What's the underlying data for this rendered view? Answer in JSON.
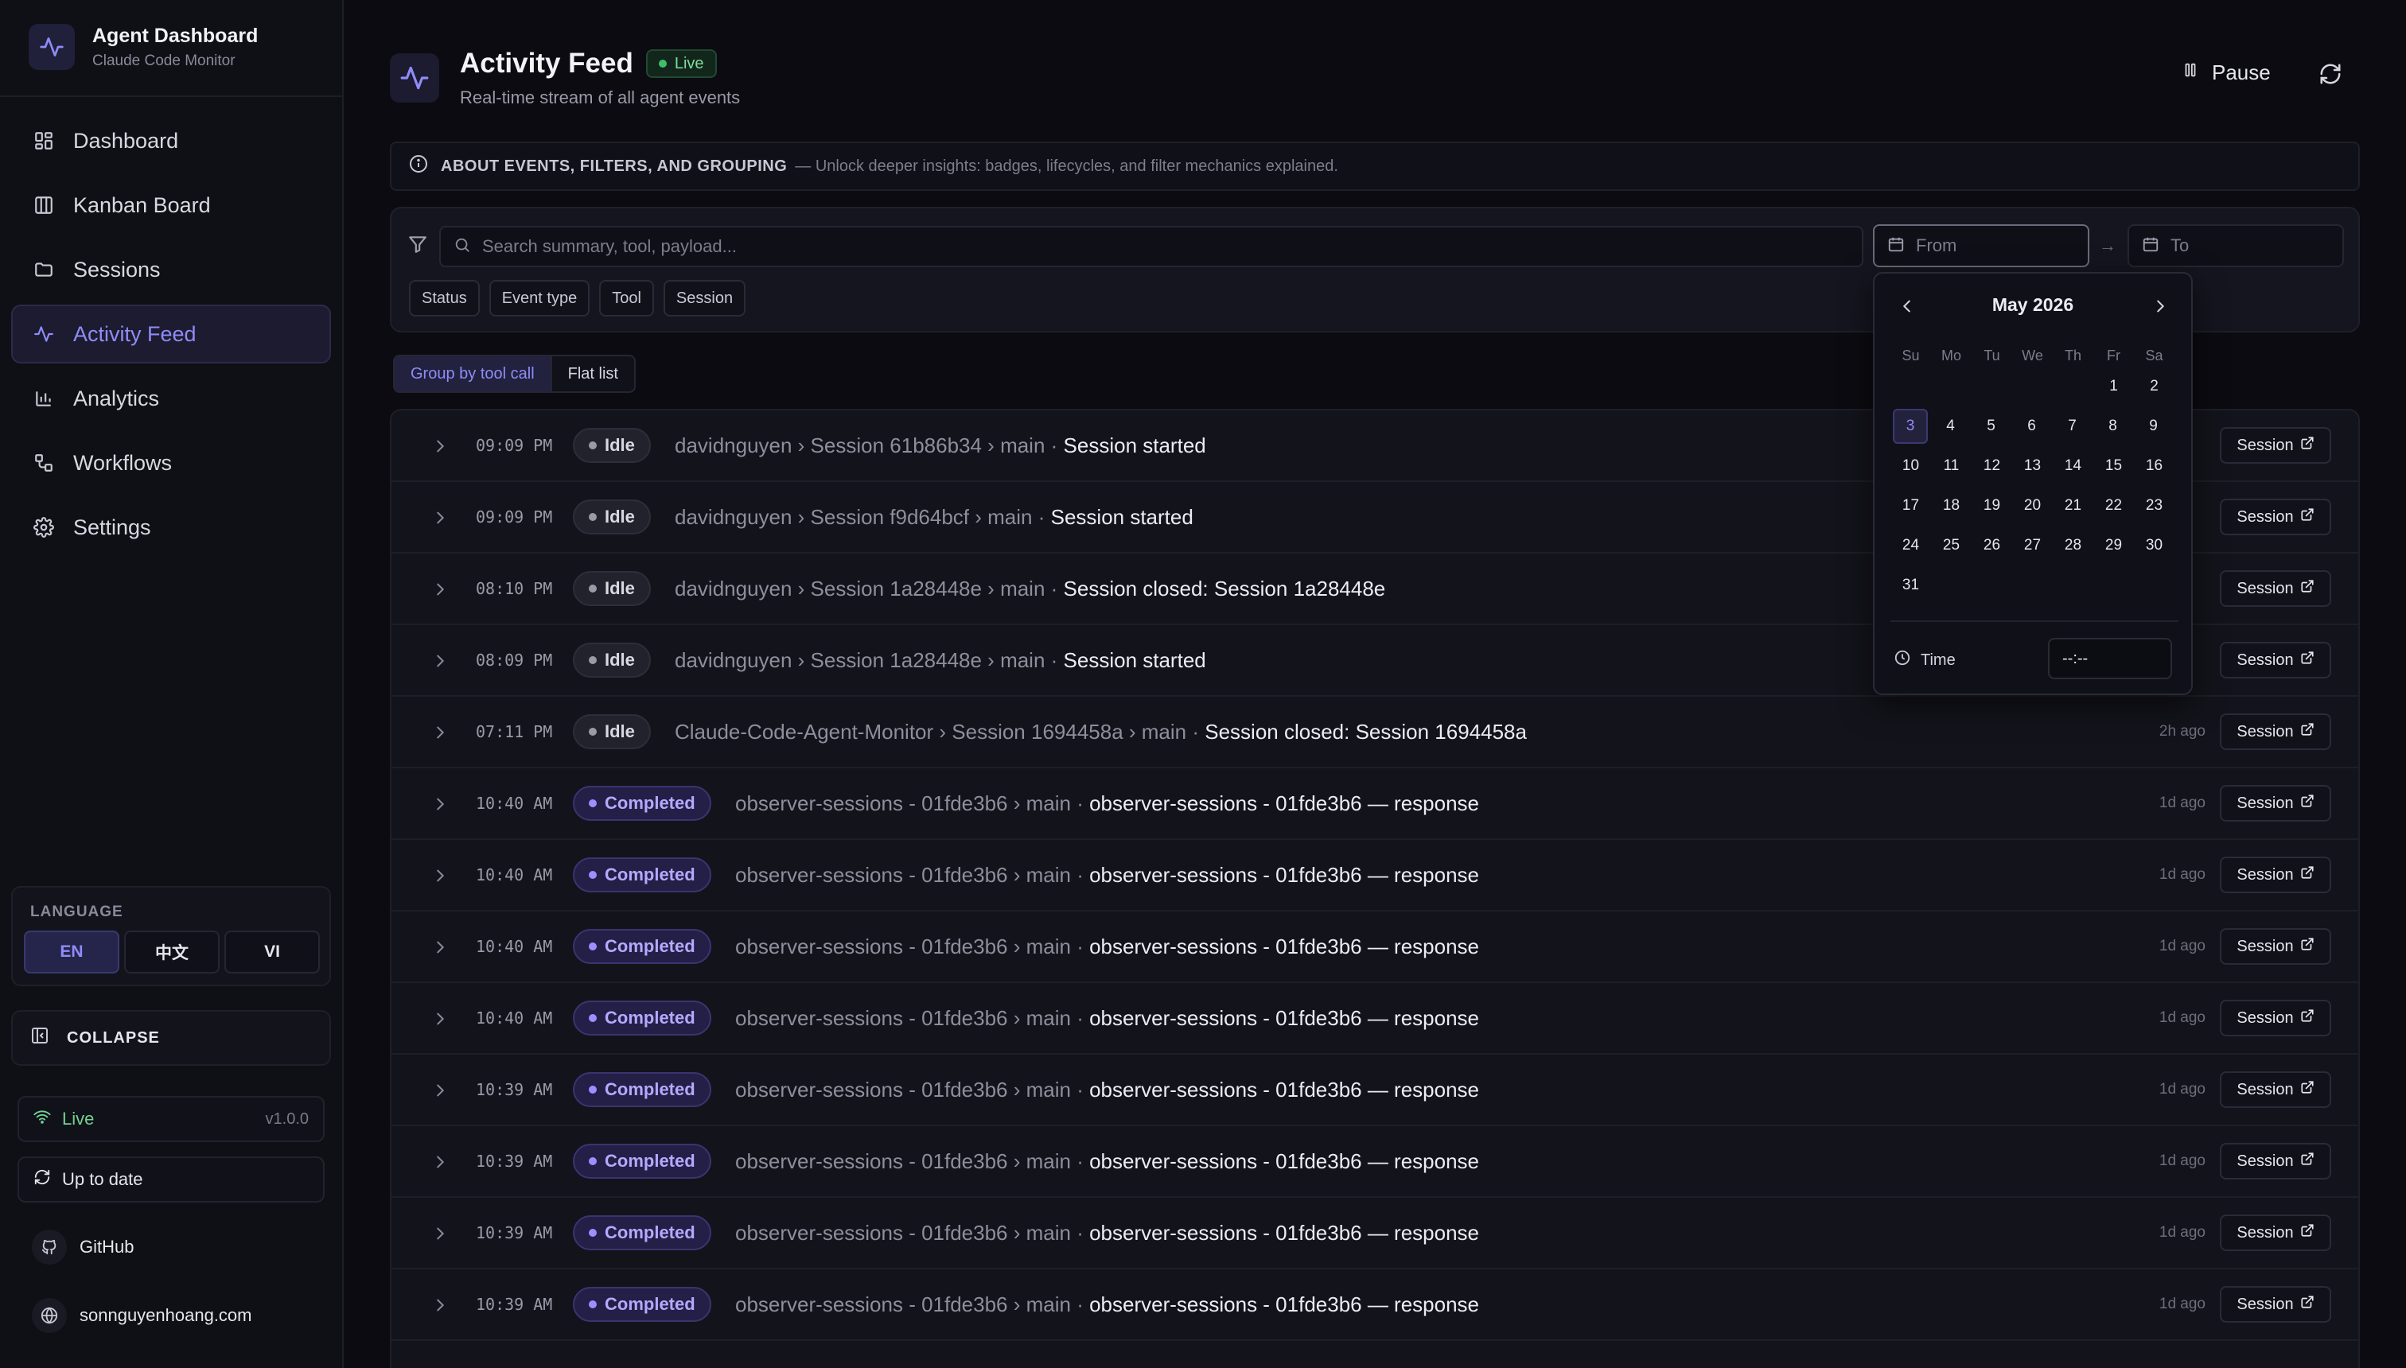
{
  "app": {
    "title": "Agent Dashboard",
    "subtitle": "Claude Code Monitor"
  },
  "nav": {
    "items": [
      {
        "label": "Dashboard",
        "icon": "dashboard-icon"
      },
      {
        "label": "Kanban Board",
        "icon": "kanban-icon"
      },
      {
        "label": "Sessions",
        "icon": "folder-icon"
      },
      {
        "label": "Activity Feed",
        "icon": "activity-icon",
        "active": true
      },
      {
        "label": "Analytics",
        "icon": "bar-chart-icon"
      },
      {
        "label": "Workflows",
        "icon": "workflow-icon"
      },
      {
        "label": "Settings",
        "icon": "gear-icon"
      }
    ]
  },
  "language": {
    "title": "LANGUAGE",
    "options": [
      "EN",
      "中文",
      "VI"
    ],
    "selected": "EN"
  },
  "collapse": {
    "label": "COLLAPSE"
  },
  "status": {
    "live_label": "Live",
    "version": "v1.0.0",
    "update_label": "Up to date"
  },
  "links": {
    "github": "GitHub",
    "website": "sonnguyenhoang.com"
  },
  "header": {
    "title": "Activity Feed",
    "badge": "Live",
    "subtitle": "Real-time stream of all agent events",
    "pause_label": "Pause"
  },
  "about": {
    "title": "ABOUT EVENTS, FILTERS, AND GROUPING",
    "desc": "— Unlock deeper insights: badges, lifecycles, and filter mechanics explained."
  },
  "filters": {
    "search_placeholder": "Search summary, tool, payload...",
    "from_placeholder": "From",
    "to_placeholder": "To",
    "arrow": "→",
    "chips": [
      "Status",
      "Event type",
      "Tool",
      "Session"
    ]
  },
  "view_toggle": {
    "grouped": "Group by tool call",
    "flat": "Flat list"
  },
  "events": [
    {
      "time": "09:09 PM",
      "status": "Idle",
      "path": "davidnguyen › Session 61b86b34 › main · ",
      "summary": "Session started",
      "ago": "",
      "action": "Session"
    },
    {
      "time": "09:09 PM",
      "status": "Idle",
      "path": "davidnguyen › Session f9d64bcf › main · ",
      "summary": "Session started",
      "ago": "",
      "action": "Session"
    },
    {
      "time": "08:10 PM",
      "status": "Idle",
      "path": "davidnguyen › Session 1a28448e › main · ",
      "summary": "Session closed: Session 1a28448e",
      "ago": "",
      "action": "Session"
    },
    {
      "time": "08:09 PM",
      "status": "Idle",
      "path": "davidnguyen › Session 1a28448e › main · ",
      "summary": "Session started",
      "ago": "",
      "action": "Session"
    },
    {
      "time": "07:11 PM",
      "status": "Idle",
      "path": "Claude-Code-Agent-Monitor › Session 1694458a › main · ",
      "summary": "Session closed: Session 1694458a",
      "ago": "2h ago",
      "action": "Session"
    },
    {
      "time": "10:40 AM",
      "status": "Completed",
      "path": "observer-sessions - 01fde3b6 › main · ",
      "summary": "observer-sessions - 01fde3b6 — response",
      "ago": "1d ago",
      "action": "Session"
    },
    {
      "time": "10:40 AM",
      "status": "Completed",
      "path": "observer-sessions - 01fde3b6 › main · ",
      "summary": "observer-sessions - 01fde3b6 — response",
      "ago": "1d ago",
      "action": "Session"
    },
    {
      "time": "10:40 AM",
      "status": "Completed",
      "path": "observer-sessions - 01fde3b6 › main · ",
      "summary": "observer-sessions - 01fde3b6 — response",
      "ago": "1d ago",
      "action": "Session"
    },
    {
      "time": "10:40 AM",
      "status": "Completed",
      "path": "observer-sessions - 01fde3b6 › main · ",
      "summary": "observer-sessions - 01fde3b6 — response",
      "ago": "1d ago",
      "action": "Session"
    },
    {
      "time": "10:39 AM",
      "status": "Completed",
      "path": "observer-sessions - 01fde3b6 › main · ",
      "summary": "observer-sessions - 01fde3b6 — response",
      "ago": "1d ago",
      "action": "Session"
    },
    {
      "time": "10:39 AM",
      "status": "Completed",
      "path": "observer-sessions - 01fde3b6 › main · ",
      "summary": "observer-sessions - 01fde3b6 — response",
      "ago": "1d ago",
      "action": "Session"
    },
    {
      "time": "10:39 AM",
      "status": "Completed",
      "path": "observer-sessions - 01fde3b6 › main · ",
      "summary": "observer-sessions - 01fde3b6 — response",
      "ago": "1d ago",
      "action": "Session"
    },
    {
      "time": "10:39 AM",
      "status": "Completed",
      "path": "observer-sessions - 01fde3b6 › main · ",
      "summary": "observer-sessions - 01fde3b6 — response",
      "ago": "1d ago",
      "action": "Session"
    }
  ],
  "calendar": {
    "month_label": "May 2026",
    "weekdays": [
      "Su",
      "Mo",
      "Tu",
      "We",
      "Th",
      "Fr",
      "Sa"
    ],
    "weeks": [
      [
        "",
        "",
        "",
        "",
        "",
        "1",
        "2"
      ],
      [
        "3",
        "4",
        "5",
        "6",
        "7",
        "8",
        "9"
      ],
      [
        "10",
        "11",
        "12",
        "13",
        "14",
        "15",
        "16"
      ],
      [
        "17",
        "18",
        "19",
        "20",
        "21",
        "22",
        "23"
      ],
      [
        "24",
        "25",
        "26",
        "27",
        "28",
        "29",
        "30"
      ],
      [
        "31",
        "",
        "",
        "",
        "",
        "",
        ""
      ]
    ],
    "today": "3",
    "time_label": "Time",
    "time_value": "--:--"
  },
  "colors": {
    "accent": "#8f8cf7",
    "live": "#3fbf6a",
    "completed": "#a08dff"
  }
}
